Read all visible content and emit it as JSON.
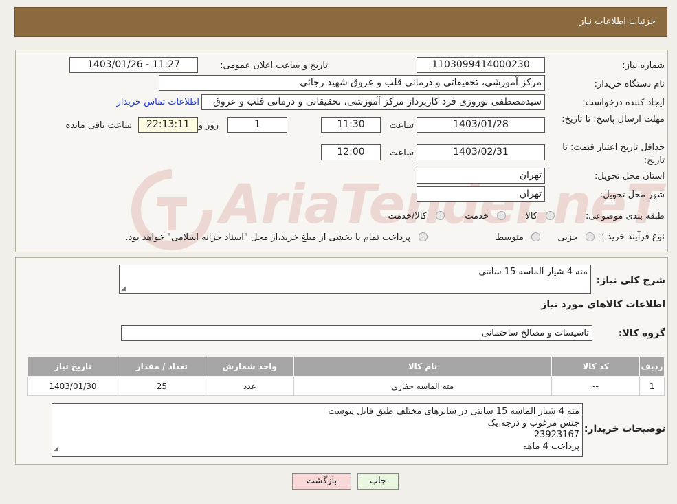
{
  "header": {
    "title": "جزئیات اطلاعات نیاز"
  },
  "form": {
    "need_number_label": "شماره نیاز:",
    "need_number": "1103099414000230",
    "announce_label": "تاریخ و ساعت اعلان عمومی:",
    "announce_value": "1403/01/26 - 11:27",
    "buyer_org_label": "نام دستگاه خریدار:",
    "buyer_org": "مرکز آموزشی، تحقیقاتی و درمانی قلب و عروق شهید رجائی",
    "requester_label": "ایجاد کننده درخواست:",
    "requester": "سیدمصطفی نوروزی فرد کارپرداز مرکز آموزشی، تحقیقاتی و درمانی قلب و عروق",
    "contact_link": "اطلاعات تماس خریدار",
    "deadline_label": "مهلت ارسال پاسخ: تا تاریخ:",
    "deadline_date": "1403/01/28",
    "time_label": "ساعت",
    "deadline_time": "11:30",
    "days_value": "1",
    "days_label": "روز و",
    "remaining_time": "22:13:11",
    "remaining_label": "ساعت باقی مانده",
    "validity_label": "حداقل تاریخ اعتبار قیمت: تا تاریخ:",
    "validity_date": "1403/02/31",
    "validity_time": "12:00",
    "province_label": "استان محل تحویل:",
    "province": "تهران",
    "city_label": "شهر محل تحویل:",
    "city": "تهران",
    "category_label": "طبقه بندی موضوعی:",
    "category_options": [
      "کالا",
      "خدمت",
      "کالا/خدمت"
    ],
    "process_label": "نوع فرآیند خرید :",
    "process_options": [
      "جزیی",
      "متوسط"
    ],
    "process_note": "پرداخت تمام یا بخشی از مبلغ خرید،از محل \"اسناد خزانه اسلامی\" خواهد بود."
  },
  "summary": {
    "desc_label": "شرح کلی نیاز:",
    "desc_value": "مته 4 شیار الماسه 15 سانتی",
    "goods_info_title": "اطلاعات کالاهای مورد نیاز",
    "goods_group_label": "گروه کالا:",
    "goods_group": "تاسیسات و مصالح ساختمانی"
  },
  "table": {
    "headers": [
      "ردیف",
      "کد کالا",
      "نام کالا",
      "واحد شمارش",
      "تعداد / مقدار",
      "تاریخ نیاز"
    ],
    "rows": [
      [
        "1",
        "--",
        "مته الماسه حفاری",
        "عدد",
        "25",
        "1403/01/30"
      ]
    ]
  },
  "notes": {
    "label": "توضیحات خریدار:",
    "lines": [
      "مته 4 شیار الماسه 15 سانتی در سایزهای مختلف طبق فایل پیوست",
      "جنس مرغوب و درجه یک",
      "23923167",
      "پرداخت 4 ماهه"
    ]
  },
  "buttons": {
    "print": "چاپ",
    "back": "بازگشت"
  },
  "watermark": {
    "text": "AriaTender.neT"
  },
  "colors": {
    "header": "#8b6a3f",
    "link": "#1c3bd1",
    "back_button": "#f8d7d7",
    "print_button": "#e9f7e0"
  }
}
